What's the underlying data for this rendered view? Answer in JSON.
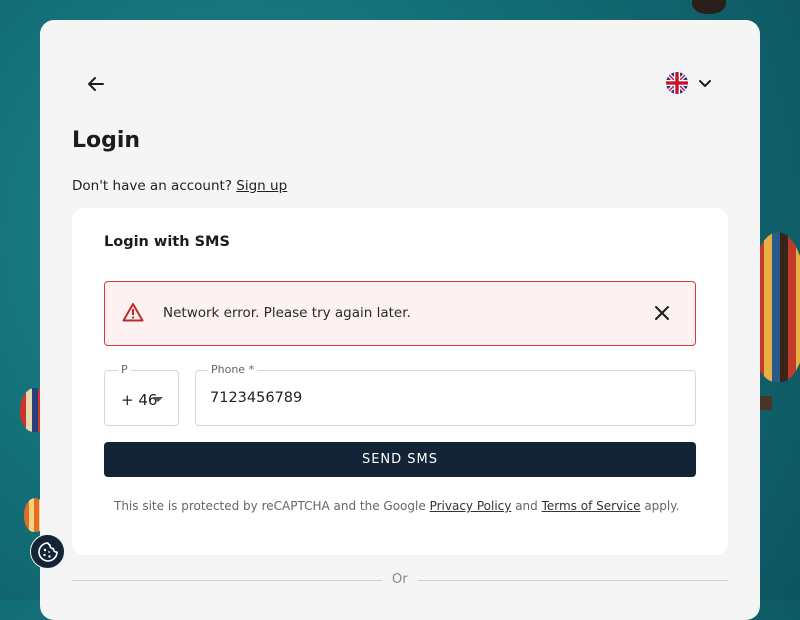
{
  "header": {
    "back_icon": "arrow-left-icon",
    "language": {
      "flag": "uk-flag-icon",
      "chevron": "chevron-down-icon"
    }
  },
  "login": {
    "title": "Login",
    "no_account_text": "Don't have an account?",
    "signup_link": "Sign up"
  },
  "sms_panel": {
    "title": "Login with SMS",
    "alert": {
      "icon": "warning-icon",
      "message": "Network error. Please try again later.",
      "close_icon": "close-icon",
      "color": "#d93838"
    },
    "country_code": {
      "label": "P",
      "value": "+ 46"
    },
    "phone": {
      "label": "Phone *",
      "value": "7123456789"
    },
    "send_button": "SEND SMS",
    "recaptcha": {
      "prefix": "This site is protected by reCAPTCHA and the Google",
      "privacy_link": "Privacy Policy",
      "and_text": "and",
      "terms_link": "Terms of Service",
      "suffix": "apply."
    }
  },
  "divider_text": "Or",
  "cookie_icon": "cookie-icon",
  "colors": {
    "primary": "#132436",
    "error": "#d93838",
    "card": "#f5f5f5"
  }
}
